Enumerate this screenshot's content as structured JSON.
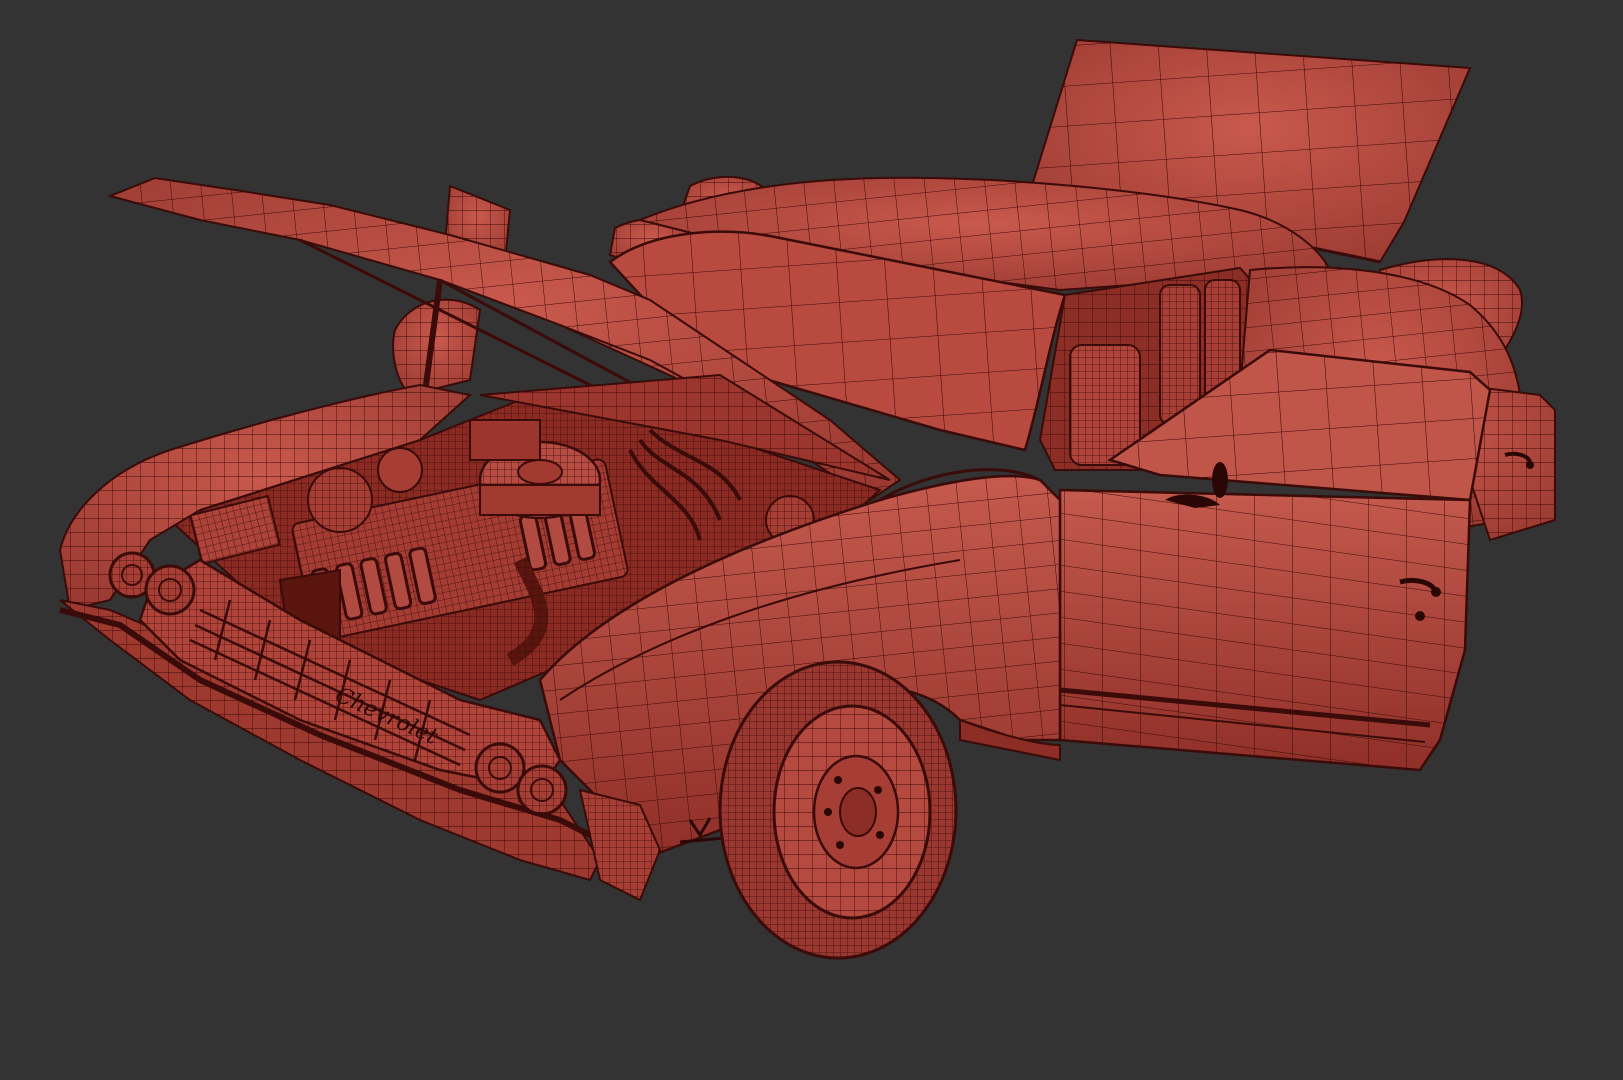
{
  "scene": {
    "background_color": "#333333",
    "mesh_color": "#b5473e",
    "wire_color": "#3a0b08",
    "highlight_color": "#d06a5c",
    "shadow_color": "#7a1f18"
  },
  "emblems": {
    "grille_script": "Chevrolet"
  }
}
